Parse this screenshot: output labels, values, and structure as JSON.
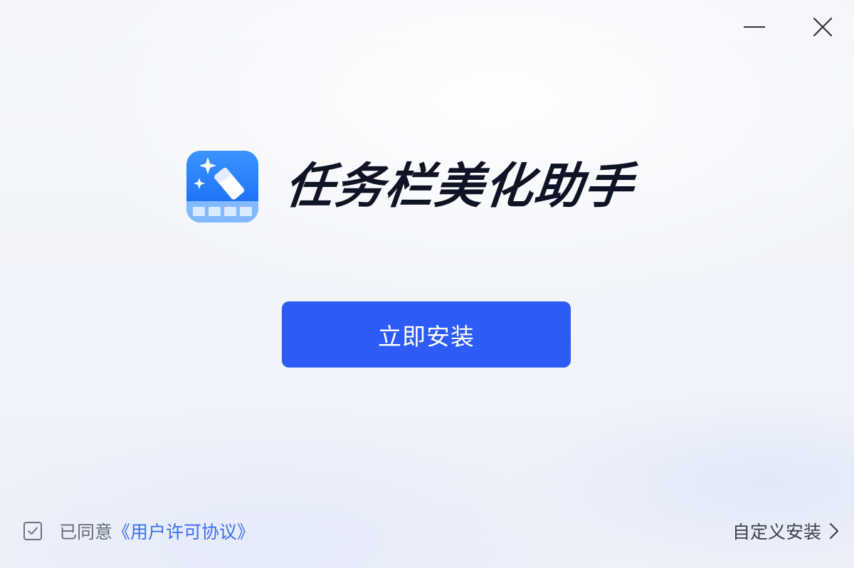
{
  "window": {
    "minimize_icon": "minimize-icon",
    "close_icon": "close-icon"
  },
  "brand": {
    "icon": "taskbar-beautify-app-icon",
    "title": "任务栏美化助手"
  },
  "install_button": {
    "label": "立即安装"
  },
  "agreement": {
    "checked": true,
    "prefix": "已同意",
    "link": "《用户许可协议》"
  },
  "custom_install": {
    "label": "自定义安装",
    "icon": "chevron-right-icon"
  },
  "colors": {
    "accent": "#2c5bf6",
    "link": "#3a6cf2",
    "title": "#0f1424",
    "icon_blue": "#1a6cf5"
  }
}
